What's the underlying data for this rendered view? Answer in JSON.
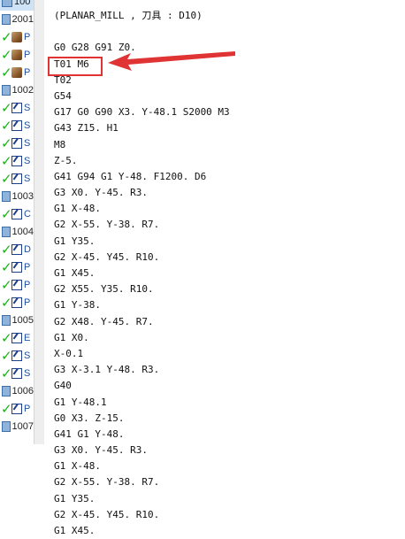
{
  "tree": {
    "rows": [
      {
        "kind": "grp",
        "label": "100",
        "check": false,
        "top": true
      },
      {
        "kind": "grp",
        "label": "2001",
        "check": false
      },
      {
        "kind": "geo",
        "label": "P",
        "check": true
      },
      {
        "kind": "geo",
        "label": "P",
        "check": true
      },
      {
        "kind": "geo",
        "label": "P",
        "check": true
      },
      {
        "kind": "grp",
        "label": "1002",
        "check": false
      },
      {
        "kind": "op",
        "label": "S",
        "check": true
      },
      {
        "kind": "op",
        "label": "S",
        "check": true
      },
      {
        "kind": "op",
        "label": "S",
        "check": true
      },
      {
        "kind": "op",
        "label": "S",
        "check": true
      },
      {
        "kind": "op",
        "label": "S",
        "check": true
      },
      {
        "kind": "grp",
        "label": "1003",
        "check": false
      },
      {
        "kind": "op",
        "label": "C",
        "check": true
      },
      {
        "kind": "grp",
        "label": "1004",
        "check": false
      },
      {
        "kind": "op",
        "label": "D",
        "check": true
      },
      {
        "kind": "op",
        "label": "P",
        "check": true
      },
      {
        "kind": "op",
        "label": "P",
        "check": true
      },
      {
        "kind": "op",
        "label": "P",
        "check": true
      },
      {
        "kind": "grp",
        "label": "1005",
        "check": false
      },
      {
        "kind": "op",
        "label": "E",
        "check": true
      },
      {
        "kind": "op",
        "label": "S",
        "check": true
      },
      {
        "kind": "op",
        "label": "S",
        "check": true
      },
      {
        "kind": "grp",
        "label": "1006",
        "check": false
      },
      {
        "kind": "op",
        "label": "P",
        "check": true
      },
      {
        "kind": "grp",
        "label": "1007",
        "check": false
      }
    ]
  },
  "editor": {
    "lines": [
      "(PLANAR_MILL , 刀具 : D10)",
      "",
      "G0 G28 G91 Z0.",
      "T01 M6",
      "T02",
      "G54",
      "G17 G0 G90 X3. Y-48.1 S2000 M3",
      "G43 Z15. H1",
      "M8",
      "Z-5.",
      "G41 G94 G1 Y-48. F1200. D6",
      "G3 X0. Y-45. R3.",
      "G1 X-48.",
      "G2 X-55. Y-38. R7.",
      "G1 Y35.",
      "G2 X-45. Y45. R10.",
      "G1 X45.",
      "G2 X55. Y35. R10.",
      "G1 Y-38.",
      "G2 X48. Y-45. R7.",
      "G1 X0.",
      "X-0.1",
      "G3 X-3.1 Y-48. R3.",
      "G40",
      "G1 Y-48.1",
      "G0 X3. Z-15.",
      "G41 G1 Y-48.",
      "G3 X0. Y-45. R3.",
      "G1 X-48.",
      "G2 X-55. Y-38. R7.",
      "G1 Y35.",
      "G2 X-45. Y45. R10.",
      "G1 X45."
    ]
  },
  "annotation": {
    "color": "#e03434",
    "target_line": "T02"
  }
}
